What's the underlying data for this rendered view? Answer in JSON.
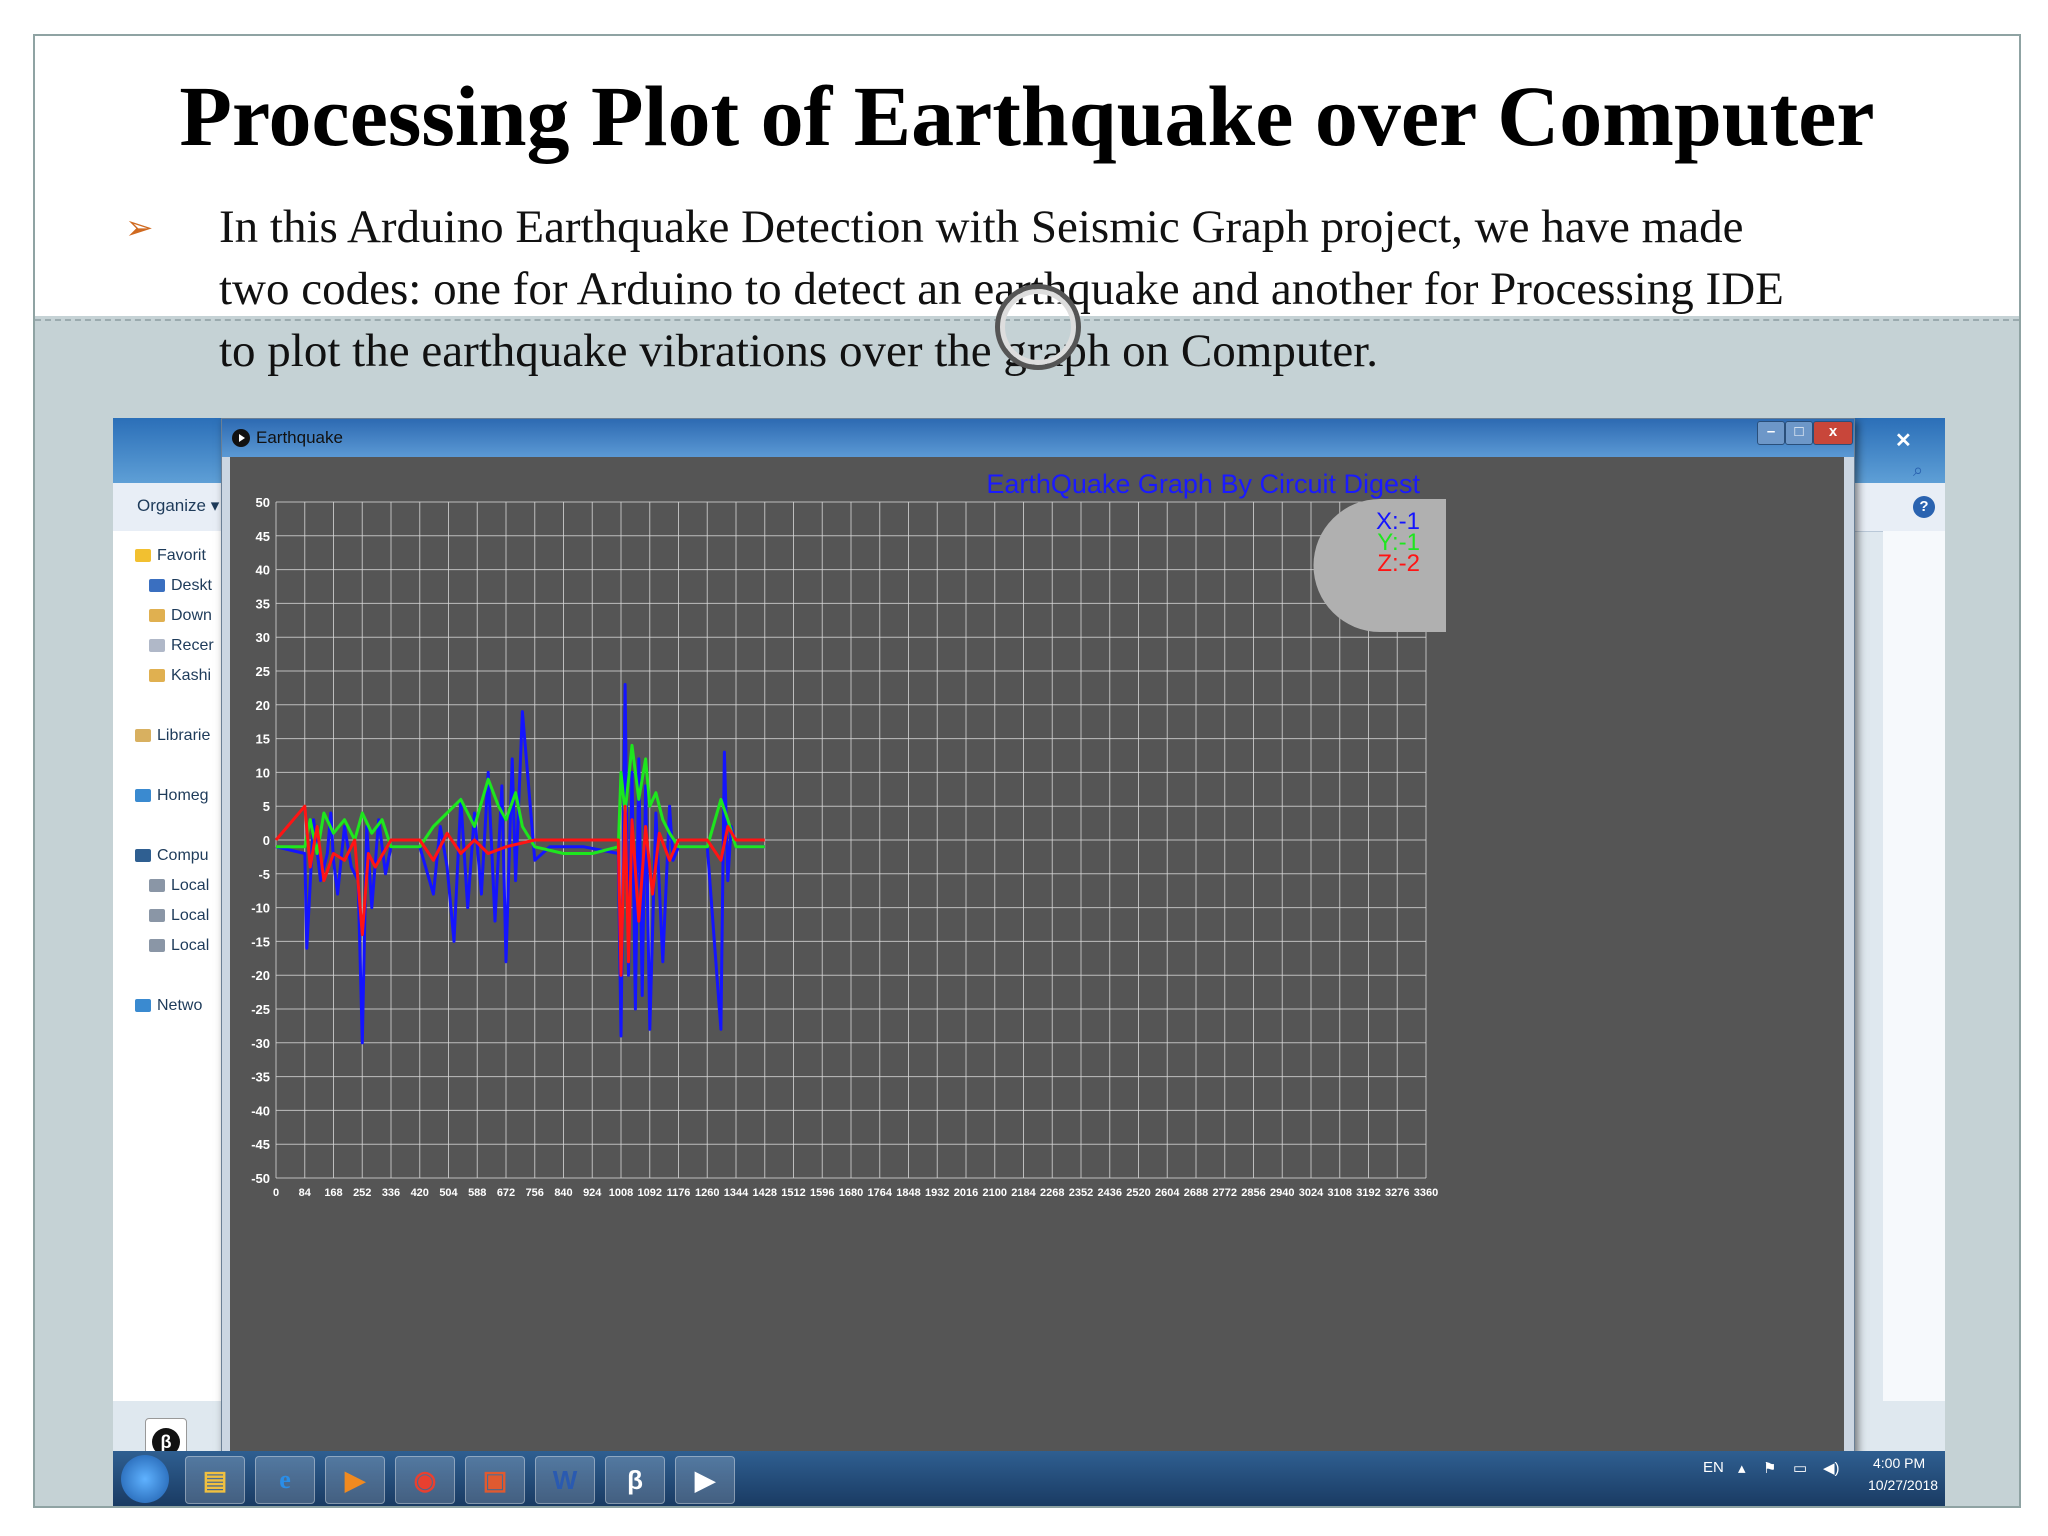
{
  "slide": {
    "title": "Processing Plot of Earthquake over Computer",
    "bullet_lines": [
      "In this Arduino Earthquake Detection with Seismic Graph project, we have made",
      "two codes: one for Arduino to detect an earthquake and another for Processing IDE",
      "to plot the earthquake vibrations over the graph on Computer."
    ]
  },
  "explorer": {
    "organize_label": "Organize ▾",
    "nav_items": [
      "Favorit",
      "Deskt",
      "Down",
      "Recer",
      "Kashi",
      "Librarie",
      "Homeg",
      "Compu",
      "Local",
      "Local",
      "Local",
      "Netwo"
    ]
  },
  "window": {
    "title": "Earthquake",
    "buttons": {
      "minimize": "–",
      "maximize": "□",
      "close": "x"
    }
  },
  "colors": {
    "x_axis_series": "#1414ff",
    "y_axis_series": "#1ee61e",
    "z_axis_series": "#ff1414",
    "plot_background": "#555555",
    "grid": "#d8d8d8"
  },
  "chart_data": {
    "type": "line",
    "title": "EarthQuake Graph By Circuit Digest",
    "ylim": [
      -50,
      50
    ],
    "xlim": [
      0,
      3360
    ],
    "y_ticks": [
      50,
      45,
      40,
      35,
      30,
      25,
      20,
      15,
      10,
      5,
      0,
      -5,
      -10,
      -15,
      -20,
      -25,
      -30,
      -35,
      -40,
      -45,
      -50
    ],
    "x_ticks": [
      0,
      84,
      168,
      252,
      336,
      420,
      504,
      588,
      672,
      756,
      840,
      924,
      1008,
      1092,
      1176,
      1260,
      1344,
      1428,
      1512,
      1596,
      1680,
      1764,
      1848,
      1932,
      2016,
      2100,
      2184,
      2268,
      2352,
      2436,
      2520,
      2604,
      2688,
      2772,
      2856,
      2940,
      3024,
      3108,
      3192,
      3276,
      3360
    ],
    "grid": true,
    "legend_position": "top-right",
    "readout": {
      "x": "X:-1",
      "y": "Y:-1",
      "z": "Z:-2"
    },
    "series": [
      {
        "x": [
          0,
          84,
          90,
          110,
          130,
          150,
          160,
          168,
          180,
          200,
          220,
          240,
          252,
          265,
          280,
          300,
          320,
          336,
          420,
          460,
          480,
          500,
          520,
          540,
          560,
          580,
          600,
          620,
          640,
          660,
          672,
          690,
          700,
          720,
          756,
          800,
          900,
          1000,
          1008,
          1020,
          1030,
          1040,
          1050,
          1060,
          1070,
          1080,
          1092,
          1110,
          1130,
          1150,
          1160,
          1176,
          1200,
          1260,
          1300,
          1310,
          1320,
          1330,
          1344,
          1360,
          1428
        ],
        "y": [
          -1,
          -2,
          -16,
          3,
          -6,
          -2,
          4,
          -3,
          -8,
          2,
          -4,
          -6,
          -30,
          2,
          -10,
          3,
          -5,
          -1,
          -1,
          -8,
          2,
          -4,
          -15,
          6,
          -10,
          4,
          -8,
          10,
          -12,
          8,
          -18,
          12,
          -6,
          19,
          -3,
          -1,
          -1,
          -2,
          -29,
          23,
          -20,
          10,
          -25,
          12,
          -23,
          8,
          -28,
          4,
          -18,
          5,
          -3,
          -1,
          -1,
          -1,
          -28,
          13,
          -6,
          2,
          -1,
          -1,
          -1
        ]
      },
      {
        "x": [
          0,
          84,
          100,
          120,
          140,
          168,
          200,
          230,
          252,
          280,
          310,
          336,
          420,
          460,
          500,
          540,
          580,
          620,
          650,
          672,
          700,
          720,
          756,
          840,
          924,
          1000,
          1008,
          1020,
          1040,
          1060,
          1080,
          1092,
          1110,
          1130,
          1150,
          1176,
          1260,
          1300,
          1320,
          1344,
          1428
        ],
        "y": [
          -1,
          -1,
          3,
          -2,
          4,
          1,
          3,
          0,
          4,
          1,
          3,
          -1,
          -1,
          2,
          4,
          6,
          2,
          9,
          5,
          3,
          7,
          2,
          -1,
          -2,
          -2,
          -1,
          10,
          4,
          14,
          6,
          12,
          5,
          7,
          3,
          1,
          -1,
          -1,
          6,
          3,
          -1,
          -1
        ]
      },
      {
        "x": [
          0,
          84,
          100,
          120,
          140,
          168,
          200,
          230,
          252,
          270,
          290,
          336,
          420,
          460,
          500,
          540,
          580,
          620,
          672,
          756,
          840,
          924,
          1000,
          1008,
          1020,
          1030,
          1040,
          1060,
          1080,
          1100,
          1120,
          1150,
          1176,
          1260,
          1300,
          1320,
          1344,
          1428
        ],
        "y": [
          0,
          5,
          -4,
          2,
          -6,
          -2,
          -3,
          0,
          -14,
          -2,
          -4,
          0,
          0,
          -3,
          1,
          -2,
          0,
          -2,
          -1,
          0,
          0,
          0,
          0,
          -20,
          5,
          -18,
          3,
          -12,
          2,
          -8,
          1,
          -3,
          0,
          0,
          -3,
          2,
          0,
          0
        ]
      }
    ]
  },
  "taskbar": {
    "lang": "EN",
    "time": "4:00 PM",
    "date": "10/27/2018"
  }
}
